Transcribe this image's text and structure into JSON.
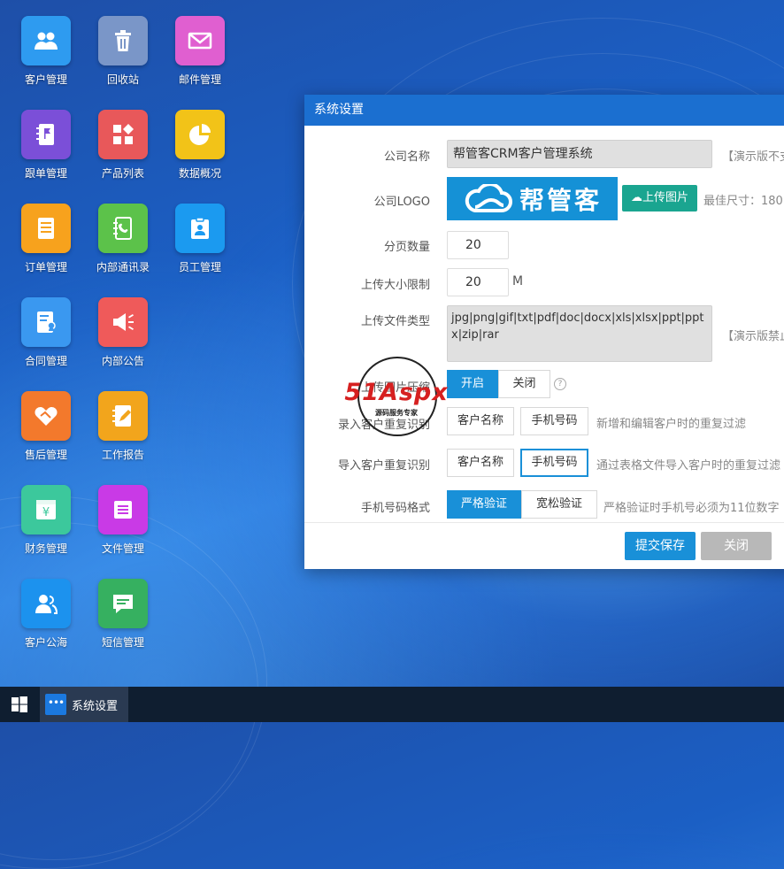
{
  "desktop_icons": [
    {
      "label": "客户管理",
      "icon": "users-icon",
      "color": "#2e9bf0"
    },
    {
      "label": "回收站",
      "icon": "trash-icon",
      "color": "#7a96c8"
    },
    {
      "label": "邮件管理",
      "icon": "mail-icon",
      "color": "#e05fd0"
    },
    {
      "label": "跟单管理",
      "icon": "notebook-flag-icon",
      "color": "#7b4fd8"
    },
    {
      "label": "产品列表",
      "icon": "product-grid-icon",
      "color": "#e8585a"
    },
    {
      "label": "数据概况",
      "icon": "pie-chart-icon",
      "color": "#f2c318"
    },
    {
      "label": "订单管理",
      "icon": "document-lines-icon",
      "color": "#f7a21d"
    },
    {
      "label": "内部通讯录",
      "icon": "address-book-icon",
      "color": "#5cc24a"
    },
    {
      "label": "员工管理",
      "icon": "clipboard-person-icon",
      "color": "#1b9af0"
    },
    {
      "label": "合同管理",
      "icon": "contract-icon",
      "color": "#3a98f0"
    },
    {
      "label": "内部公告",
      "icon": "megaphone-icon",
      "color": "#ef5a5a"
    },
    {
      "label": "售后管理",
      "icon": "handshake-icon",
      "color": "#f3792c"
    },
    {
      "label": "工作报告",
      "icon": "report-edit-icon",
      "color": "#f2a51c"
    },
    {
      "label": "财务管理",
      "icon": "yen-icon",
      "color": "#3cc89c"
    },
    {
      "label": "文件管理",
      "icon": "file-list-icon",
      "color": "#c93ae6"
    },
    {
      "label": "客户公海",
      "icon": "user-group-icon",
      "color": "#1c92ee"
    },
    {
      "label": "短信管理",
      "icon": "chat-icon",
      "color": "#36b060"
    }
  ],
  "dialog": {
    "title": "系统设置",
    "company_name": {
      "label": "公司名称",
      "value": "帮管客CRM客户管理系统",
      "note": "【演示版不支"
    },
    "company_logo": {
      "label": "公司LOGO",
      "logo_text": "帮管客",
      "upload_label": "上传图片",
      "note": "最佳尺寸：180"
    },
    "page_size": {
      "label": "分页数量",
      "value": "20"
    },
    "upload_limit": {
      "label": "上传大小限制",
      "value": "20",
      "unit": "M"
    },
    "file_types": {
      "label": "上传文件类型",
      "value": "jpg|png|gif|txt|pdf|doc|docx|xls|xlsx|ppt|pptx|zip|rar",
      "note": "【演示版禁止"
    },
    "image_compress": {
      "label": "上传图片压缩",
      "on": "开启",
      "off": "关闭",
      "help": "?"
    },
    "dup_entry": {
      "label": "录入客户重复识别",
      "opt1": "客户名称",
      "opt2": "手机号码",
      "note": "新增和编辑客户时的重复过滤"
    },
    "dup_import": {
      "label": "导入客户重复识别",
      "opt1": "客户名称",
      "opt2": "手机号码",
      "note": "通过表格文件导入客户时的重复过滤"
    },
    "phone_format": {
      "label": "手机号码格式",
      "opt1": "严格验证",
      "opt2": "宽松验证",
      "note": "严格验证时手机号必须为11位数字"
    },
    "submit": "提交保存",
    "close": "关闭"
  },
  "watermark": {
    "brand": "51Aspx",
    "sub": "源码服务专家"
  },
  "taskbar": {
    "active_item": "系统设置"
  }
}
